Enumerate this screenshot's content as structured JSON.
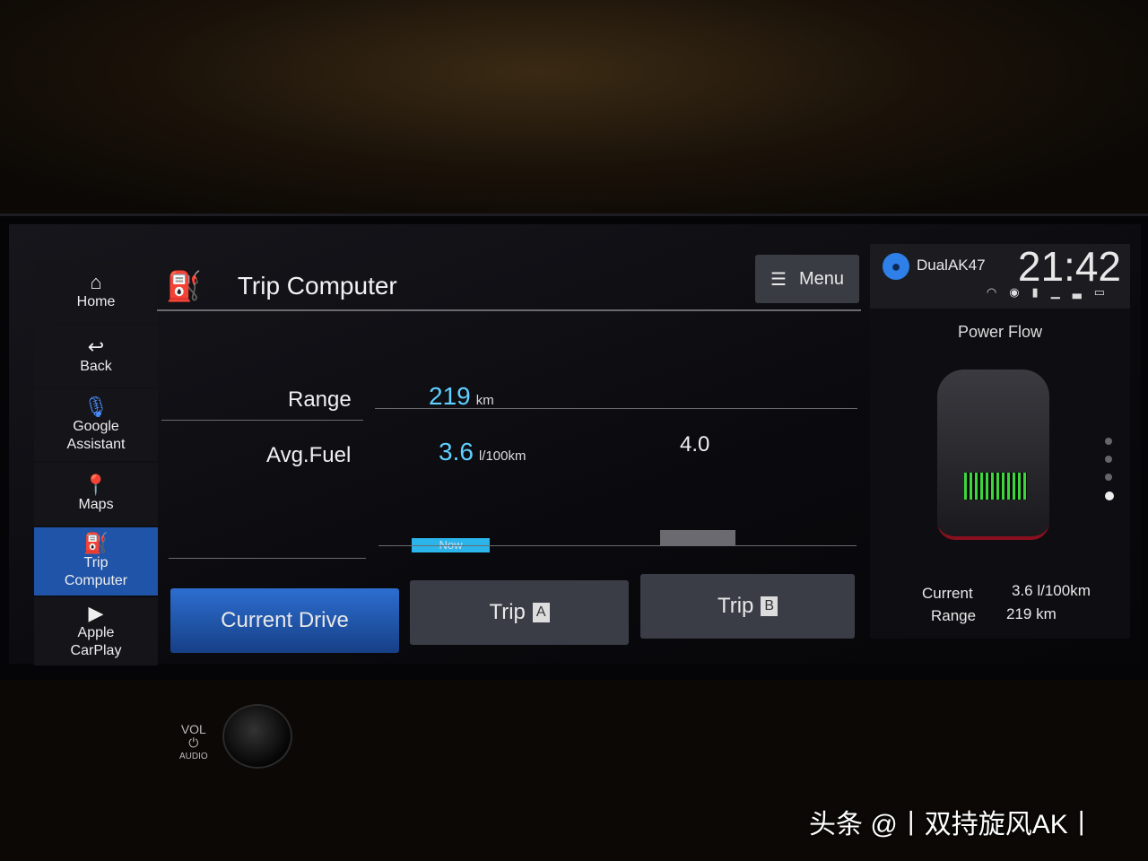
{
  "sidebar": {
    "items": [
      {
        "label": "Home",
        "icon": "home-icon"
      },
      {
        "label": "Back",
        "icon": "back-icon"
      },
      {
        "label": "Google Assistant",
        "icon": "microphone-icon"
      },
      {
        "label": "Maps",
        "icon": "maps-icon"
      },
      {
        "label": "Trip Computer",
        "icon": "fuel-pump-icon",
        "active": true
      },
      {
        "label": "Apple CarPlay",
        "icon": "carplay-icon"
      }
    ]
  },
  "header": {
    "title": "Trip Computer",
    "menu_label": "Menu"
  },
  "main": {
    "range_label": "Range",
    "range_value": "219",
    "range_unit": "km",
    "avg_fuel_label": "Avg.Fuel",
    "avg_fuel_value": "3.6",
    "avg_fuel_unit": "l/100km",
    "compare_value": "4.0",
    "now_bar_label": "Now"
  },
  "tabs": [
    {
      "label": "Current Drive",
      "active": true
    },
    {
      "label": "Trip",
      "badge": "A"
    },
    {
      "label": "Trip",
      "badge": "B"
    }
  ],
  "status": {
    "user": "DualAK47",
    "time": "21:42"
  },
  "power_flow": {
    "title": "Power Flow",
    "current_label": "Current",
    "current_value": "3.6 l/100km",
    "range_label": "Range",
    "range_value": "219 km",
    "page_dots": 4,
    "active_dot": 4
  },
  "hardware": {
    "vol_label": "VOL",
    "audio_label": "AUDIO"
  },
  "watermark": "头条 @丨双持旋风AK丨",
  "colors": {
    "accent": "#1f54a8",
    "value": "#5fd0ff",
    "battery": "#3bd63b"
  }
}
